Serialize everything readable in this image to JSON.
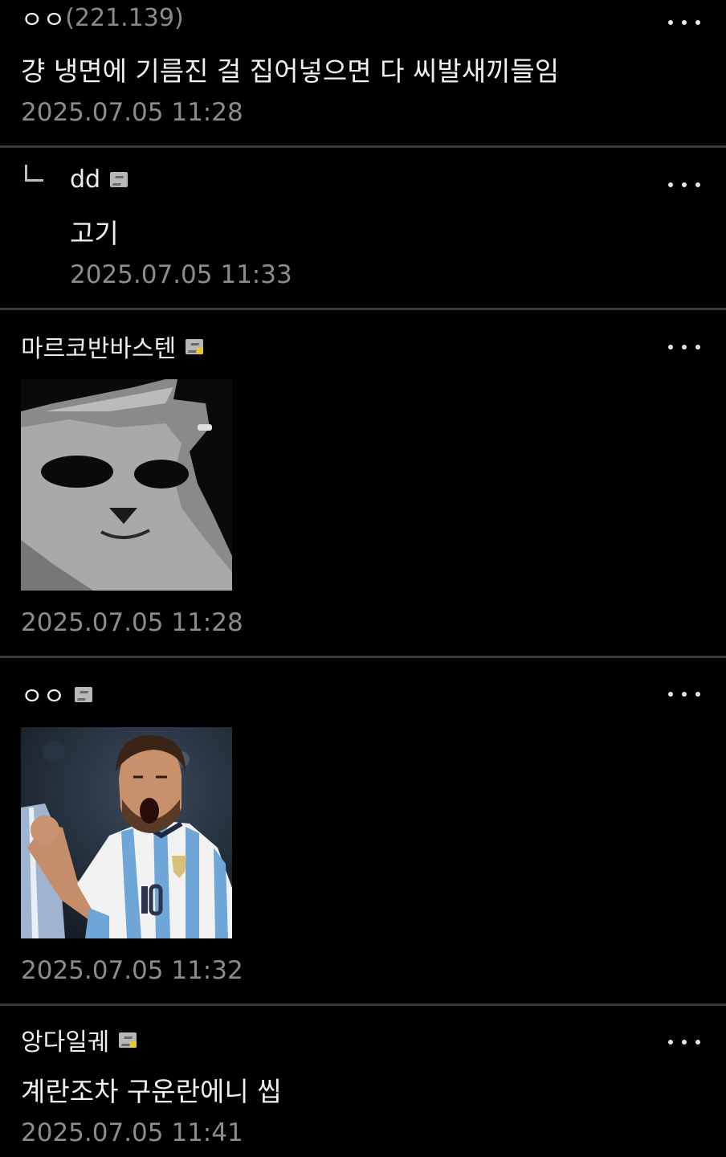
{
  "comments": [
    {
      "author": "ㅇㅇ",
      "ip": "(221.139)",
      "text": "걍 냉면에 기름진 걸 집어넣으면 다 씨발새끼들임",
      "date": "2025.07.05 11:28"
    },
    {
      "author": "dd",
      "text": "고기",
      "date": "2025.07.05 11:33",
      "is_reply": true
    },
    {
      "author": "마르코반바스텐",
      "date": "2025.07.05 11:28",
      "image": "cat-face-meme-image"
    },
    {
      "author": "ㅇㅇ",
      "date": "2025.07.05 11:32",
      "image": "soccer-player-celebrating-image"
    },
    {
      "author": "앙다일궤",
      "text": "계란조차 구운란에니 씹",
      "date": "2025.07.05 11:41"
    }
  ],
  "icons": {
    "more": "more-options-icon",
    "reply": "reply-arrow-icon",
    "badge": "member-badge-icon"
  },
  "colors": {
    "background": "#000000",
    "text": "#eeeeee",
    "date": "#8c8c8c",
    "divider": "#3a3a3a",
    "badge_accent": "#e8c92a"
  }
}
